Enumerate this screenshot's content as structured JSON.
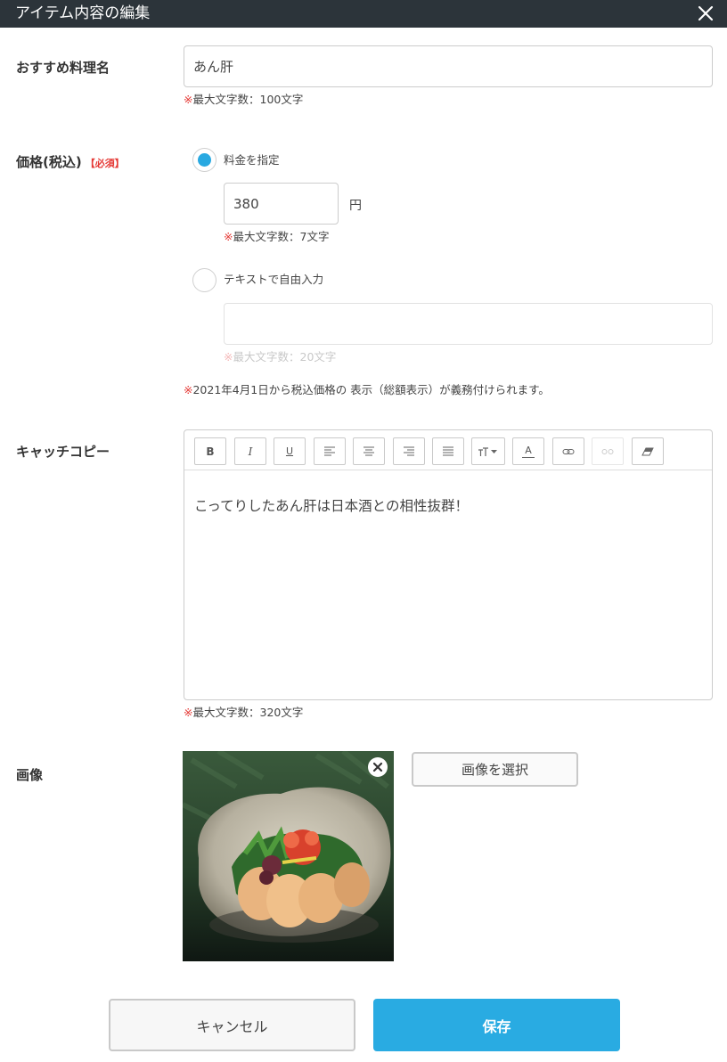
{
  "dialog": {
    "title": "アイテム内容の編集",
    "close_icon": "close-icon"
  },
  "menu_name": {
    "label": "おすすめ料理名",
    "value": "あん肝",
    "note_mark": "※",
    "note_text": "最大文字数：100文字"
  },
  "price": {
    "label": "価格(税込)",
    "required": "【必須】",
    "option_fixed": {
      "label": "料金を指定",
      "selected": true
    },
    "amount_value": "380",
    "unit": "円",
    "amount_note_mark": "※",
    "amount_note_text": "最大文字数：7文字",
    "option_text": {
      "label": "テキストで自由入力",
      "selected": false
    },
    "text_value": "",
    "text_note_mark": "※",
    "text_note_text": "最大文字数：20文字",
    "tax_note_mark": "※",
    "tax_note_text": "2021年4月1日から税込価格の 表示（総額表示）が義務付けられます。"
  },
  "catch_copy": {
    "label": "キャッチコピー",
    "toolbar": [
      {
        "name": "bold-button",
        "icon": "bold-icon",
        "text": "B"
      },
      {
        "name": "italic-button",
        "icon": "italic-icon",
        "text": "I"
      },
      {
        "name": "underline-button",
        "icon": "underline-icon",
        "text": "U"
      },
      {
        "name": "align-left-button",
        "icon": "align-left-icon"
      },
      {
        "name": "align-center-button",
        "icon": "align-center-icon"
      },
      {
        "name": "align-right-button",
        "icon": "align-right-icon"
      },
      {
        "name": "align-justify-button",
        "icon": "align-justify-icon"
      },
      {
        "name": "font-size-button",
        "icon": "font-size-icon"
      },
      {
        "name": "font-color-button",
        "icon": "font-color-icon",
        "text": "A"
      },
      {
        "name": "link-button",
        "icon": "link-icon"
      },
      {
        "name": "unlink-button",
        "icon": "unlink-icon"
      },
      {
        "name": "clear-format-button",
        "icon": "eraser-icon"
      }
    ],
    "content": "こってりしたあん肝は日本酒との相性抜群！",
    "note_mark": "※",
    "note_text": "最大文字数：320文字"
  },
  "image": {
    "label": "画像",
    "remove_icon": "close-circle-icon",
    "select_button": "画像を選択"
  },
  "actions": {
    "cancel": "キャンセル",
    "save": "保存"
  },
  "colors": {
    "accent": "#29abe2",
    "required": "#e53935",
    "titlebar": "#2c343a"
  }
}
